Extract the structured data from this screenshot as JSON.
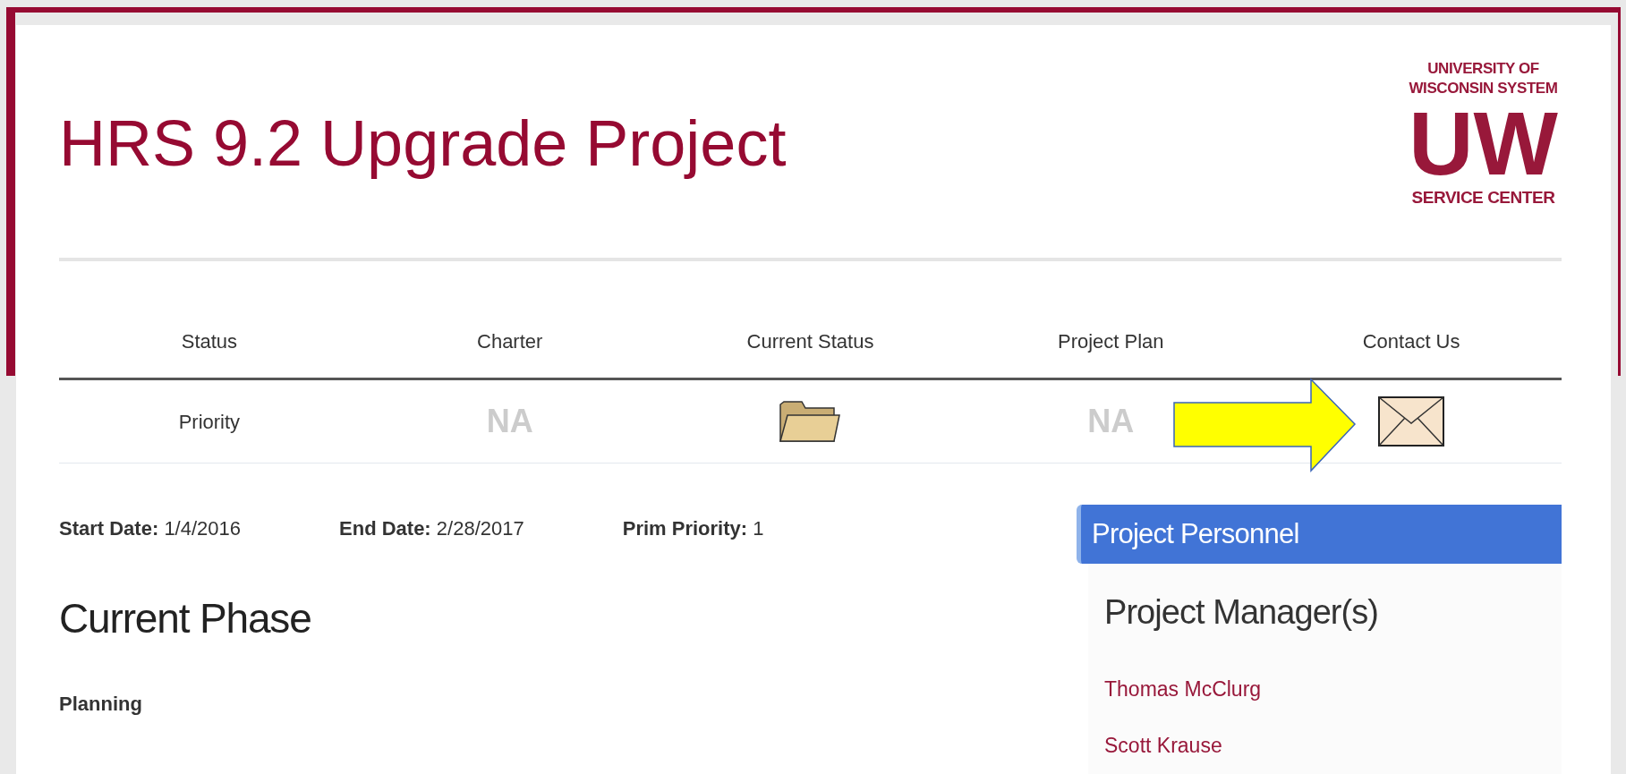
{
  "title": "HRS 9.2 Upgrade Project",
  "logo": {
    "top": [
      "UNIVERSITY OF",
      "WISCONSIN SYSTEM"
    ],
    "mark": "UW",
    "bottom": "SERVICE CENTER"
  },
  "table": {
    "columns": [
      "Status",
      "Charter",
      "Current Status",
      "Project Plan",
      "Contact Us"
    ],
    "rows": [
      [
        {
          "kind": "text",
          "text": "Priority"
        },
        {
          "kind": "na",
          "text": "NA"
        },
        {
          "kind": "folder"
        },
        {
          "kind": "na",
          "text": "NA"
        },
        {
          "kind": "envelope"
        }
      ]
    ]
  },
  "facts": [
    {
      "label": "Start Date:",
      "value": "1/4/2016"
    },
    {
      "label": "End Date:",
      "value": "2/28/2017"
    },
    {
      "label": "Prim Priority:",
      "value": "1"
    }
  ],
  "phase": {
    "heading": "Current Phase",
    "value": "Planning"
  },
  "personnel": {
    "title": "Project Personnel",
    "heading": "Project Manager(s)",
    "people": [
      "Thomas McClurg",
      "Scott Krause"
    ]
  }
}
